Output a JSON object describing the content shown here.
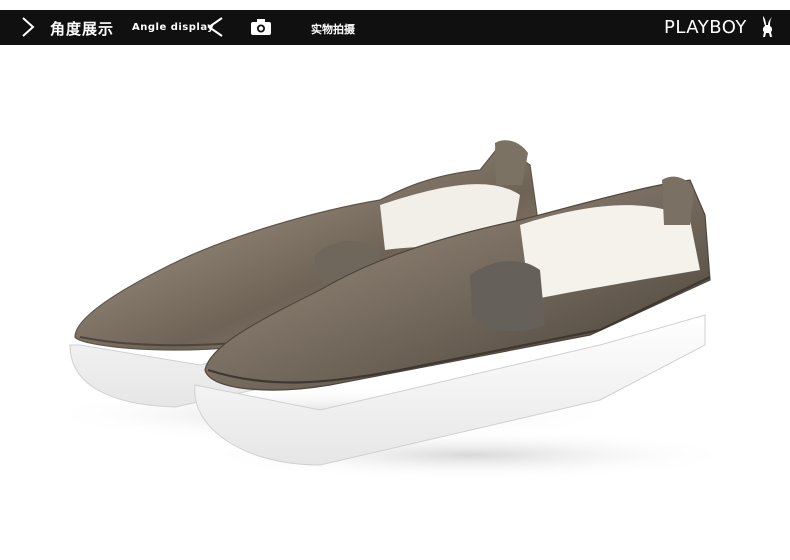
{
  "header": {
    "title_cn": "角度展示",
    "title_en": "Angle display",
    "photo_label": "实物拍摄",
    "brand": "PLAYBOY",
    "icons": [
      "chevron-right-icon",
      "chevron-left-icon",
      "camera-icon",
      "bunny-icon"
    ],
    "background_color": "#101010",
    "text_color": "#ffffff"
  },
  "product": {
    "shoe_color": "#8a7e6f",
    "sole_color": "#f4f4f4"
  }
}
